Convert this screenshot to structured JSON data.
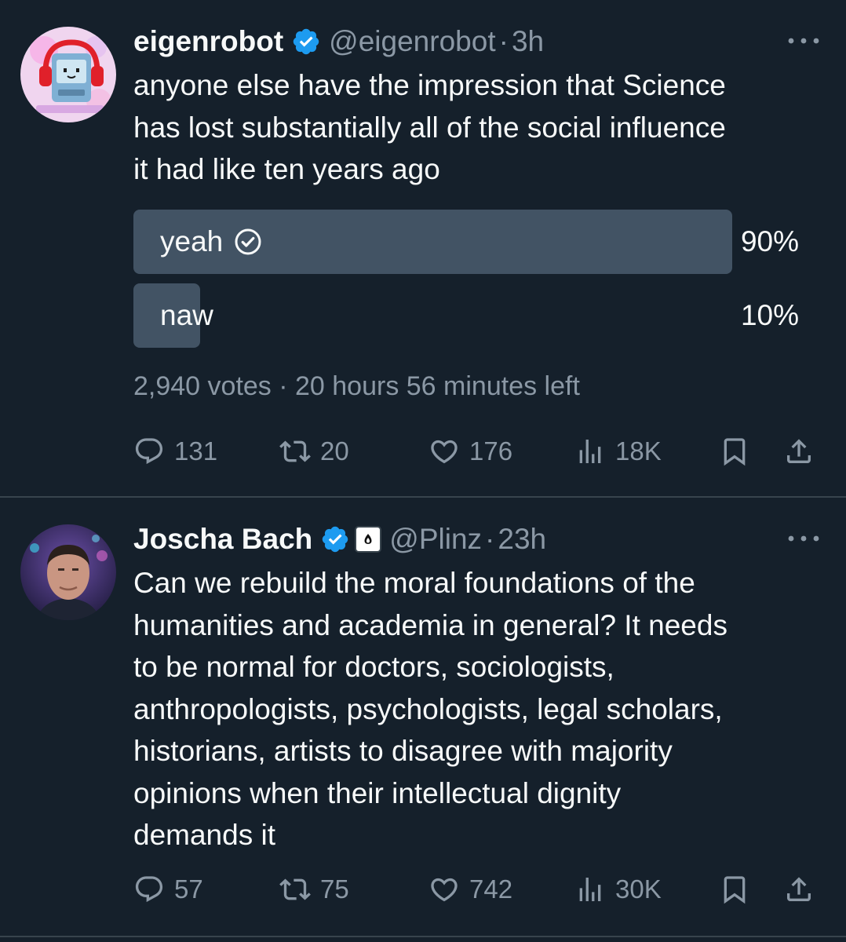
{
  "tweets": [
    {
      "name": "eigenrobot",
      "handle": "@eigenrobot",
      "separator": "·",
      "time": "3h",
      "text_lines": [
        "anyone else have the impression that Science",
        "has lost substantially all of the social influence",
        "it had like ten years ago"
      ],
      "poll": {
        "options": [
          {
            "label": "yeah",
            "percent_label": "90%",
            "share": 0.9,
            "selected": true
          },
          {
            "label": "naw",
            "percent_label": "10%",
            "share": 0.1,
            "selected": false
          }
        ],
        "meta": "2,940 votes · 20 hours 56 minutes left"
      },
      "actions": {
        "replies": "131",
        "reposts": "20",
        "likes": "176",
        "views": "18K"
      }
    },
    {
      "name": "Joscha Bach",
      "handle": "@Plinz",
      "separator": "·",
      "time": "23h",
      "text_lines": [
        "Can we rebuild the moral foundations of the",
        "humanities and academia in general? It needs",
        "to be normal for doctors, sociologists,",
        "anthropologists, psychologists, legal scholars,",
        "historians, artists to disagree with majority",
        "opinions when their intellectual dignity",
        "demands it"
      ],
      "actions": {
        "replies": "57",
        "reposts": "75",
        "likes": "742",
        "views": "30K"
      }
    }
  ],
  "icons": {
    "verified": "verified-badge-icon",
    "affiliation": "affiliation-logo-icon",
    "more": "more-options-icon",
    "reply": "reply-icon",
    "repost": "repost-icon",
    "like": "like-icon",
    "views": "views-icon",
    "bookmark": "bookmark-icon",
    "share": "share-icon",
    "poll_check": "check-circle-icon"
  },
  "colors": {
    "background": "#15202b",
    "text": "#f7f9f9",
    "secondary": "#8b98a5",
    "verified": "#1d9bf0",
    "poll_bar": "#425364",
    "divider": "#38444d"
  }
}
